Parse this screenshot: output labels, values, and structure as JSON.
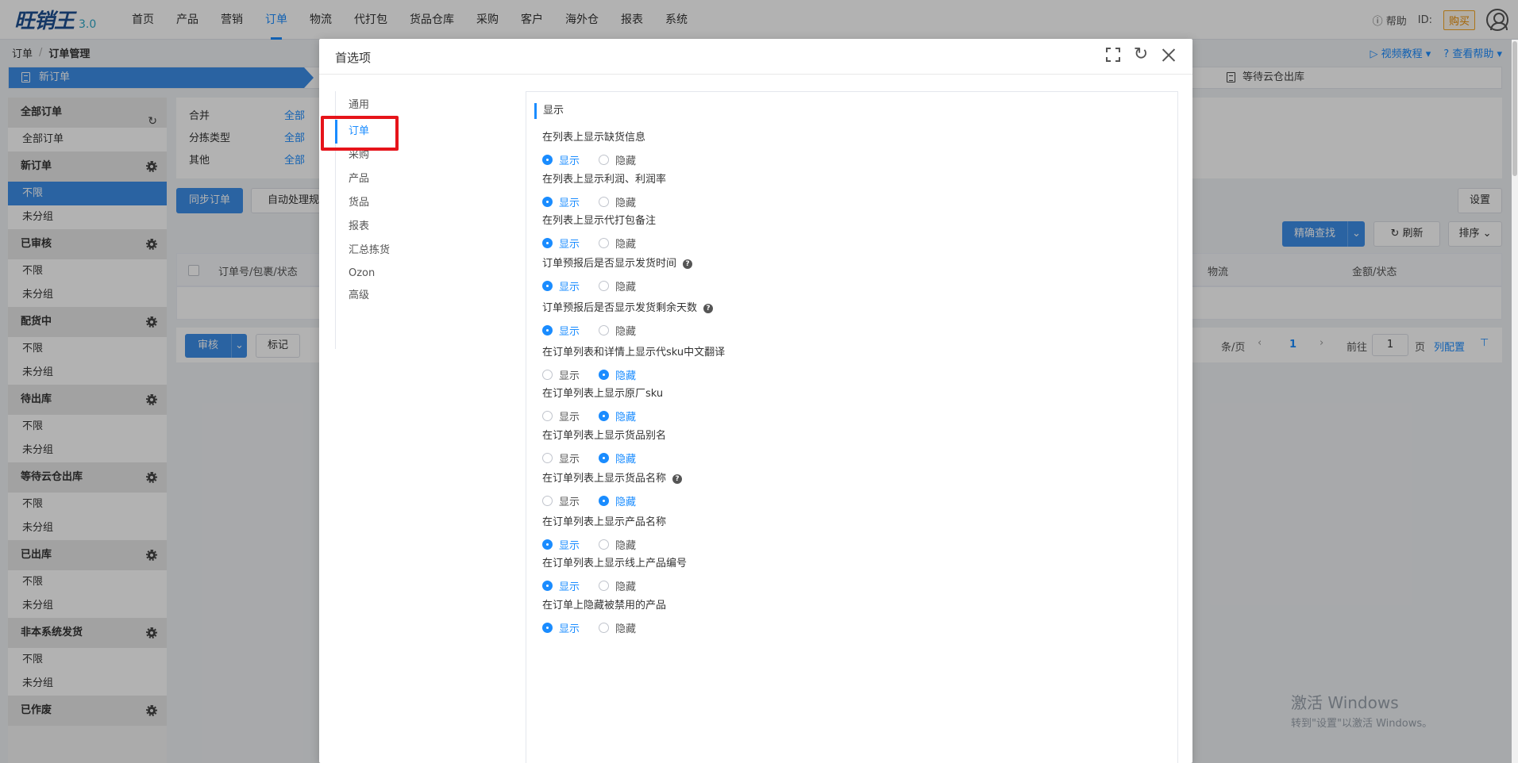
{
  "app": {
    "logo": "旺销王",
    "version": "3.0"
  },
  "topnav": [
    "首页",
    "产品",
    "营销",
    "订单",
    "物流",
    "代打包",
    "货品仓库",
    "采购",
    "客户",
    "海外仓",
    "报表",
    "系统"
  ],
  "topright": {
    "help": "帮助",
    "id_label": "ID:",
    "buy": "购买"
  },
  "breadcrumb": [
    "订单",
    "订单管理"
  ],
  "helpers": {
    "video": "视频教程",
    "help": "查看帮助"
  },
  "flow": {
    "first": "新订单",
    "last": "等待云仓出库"
  },
  "sidebar": [
    {
      "group": "全部订单",
      "icon": "refresh-icon",
      "items": [
        {
          "label": "全部订单",
          "active": false
        }
      ]
    },
    {
      "group": "新订单",
      "icon": "gear-icon",
      "items": [
        {
          "label": "不限",
          "active": true
        },
        {
          "label": "未分组",
          "active": false
        }
      ]
    },
    {
      "group": "已审核",
      "icon": "gear-icon",
      "items": [
        {
          "label": "不限",
          "active": false
        },
        {
          "label": "未分组",
          "active": false
        }
      ]
    },
    {
      "group": "配货中",
      "icon": "gear-icon",
      "items": [
        {
          "label": "不限",
          "active": false
        },
        {
          "label": "未分组",
          "active": false
        }
      ]
    },
    {
      "group": "待出库",
      "icon": "gear-icon",
      "items": [
        {
          "label": "不限",
          "active": false
        },
        {
          "label": "未分组",
          "active": false
        }
      ]
    },
    {
      "group": "等待云仓出库",
      "icon": "gear-icon",
      "items": [
        {
          "label": "不限",
          "active": false
        },
        {
          "label": "未分组",
          "active": false
        }
      ]
    },
    {
      "group": "已出库",
      "icon": "gear-icon",
      "items": [
        {
          "label": "不限",
          "active": false
        },
        {
          "label": "未分组",
          "active": false
        }
      ]
    },
    {
      "group": "非本系统发货",
      "icon": "gear-icon",
      "items": [
        {
          "label": "不限",
          "active": false
        },
        {
          "label": "未分组",
          "active": false
        }
      ]
    },
    {
      "group": "已作废",
      "icon": "gear-icon",
      "items": []
    }
  ],
  "filters": [
    {
      "label": "合并",
      "value": "全部"
    },
    {
      "label": "分拣类型",
      "value": "全部"
    },
    {
      "label": "其他",
      "value": "全部"
    }
  ],
  "toolbar": {
    "sync": "同步订单",
    "auto_rules": "自动处理规则",
    "settings": "设置",
    "precise_search": "精确查找",
    "refresh": "刷新",
    "sort": "排序"
  },
  "table": {
    "col_order": "订单号/包裹/状态",
    "col_logistics": "物流",
    "col_amount": "金额/状态"
  },
  "actions": {
    "review": "审核",
    "mark": "标记"
  },
  "pager": {
    "per_page": "条/页",
    "current": "1",
    "goto": "前往",
    "goto_value": "1",
    "page": "页",
    "col_config": "列配置"
  },
  "watermark": {
    "line1": "激活 Windows",
    "line2": "转到\"设置\"以激活 Windows。"
  },
  "modal": {
    "title": "首选项",
    "tabs": [
      {
        "label": "通用",
        "active": false
      },
      {
        "label": "订单",
        "active": true
      },
      {
        "label": "采购",
        "active": false
      },
      {
        "label": "产品",
        "active": false
      },
      {
        "label": "货品",
        "active": false
      },
      {
        "label": "报表",
        "active": false
      },
      {
        "label": "汇总拣货",
        "active": false
      },
      {
        "label": "Ozon",
        "active": false
      },
      {
        "label": "高级",
        "active": false
      }
    ],
    "section": "显示",
    "show_label": "显示",
    "hide_label": "隐藏",
    "options": [
      {
        "label": "在列表上显示缺货信息",
        "help": false,
        "value": "显示"
      },
      {
        "label": "在列表上显示利润、利润率",
        "help": false,
        "value": "显示"
      },
      {
        "label": "在列表上显示代打包备注",
        "help": false,
        "value": "显示"
      },
      {
        "label": "订单预报后是否显示发货时间",
        "help": true,
        "value": "显示"
      },
      {
        "label": "订单预报后是否显示发货剩余天数",
        "help": true,
        "value": "显示"
      },
      {
        "label": "在订单列表和详情上显示代sku中文翻译",
        "help": false,
        "value": "隐藏"
      },
      {
        "label": "在订单列表上显示原厂sku",
        "help": false,
        "value": "隐藏"
      },
      {
        "label": "在订单列表上显示货品别名",
        "help": false,
        "value": "隐藏"
      },
      {
        "label": "在订单列表上显示货品名称",
        "help": true,
        "value": "隐藏"
      },
      {
        "label": "在订单列表上显示产品名称",
        "help": false,
        "value": "显示"
      },
      {
        "label": "在订单列表上显示线上产品编号",
        "help": false,
        "value": "显示"
      },
      {
        "label": "在订单上隐藏被禁用的产品",
        "help": false,
        "value": "显示"
      }
    ]
  }
}
